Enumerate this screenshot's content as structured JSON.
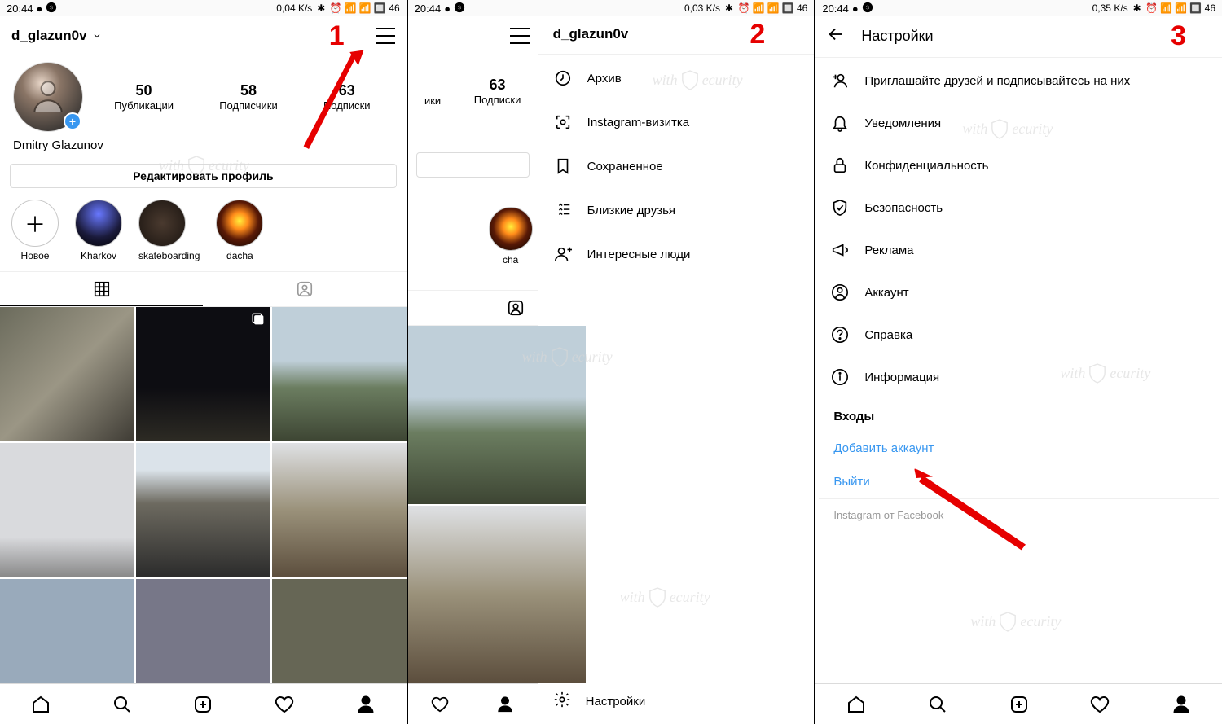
{
  "status": {
    "time": "20:44",
    "battery": "46",
    "rates": [
      "0,04 K/s",
      "0,03 K/s",
      "0,35 K/s"
    ]
  },
  "labels": {
    "1": "1",
    "2": "2",
    "3": "3"
  },
  "profile": {
    "username": "d_glazun0v",
    "display_name": "Dmitry Glazunov",
    "edit_button": "Редактировать профиль",
    "stats": {
      "posts": {
        "num": "50",
        "label": "Публикации"
      },
      "followers": {
        "num": "58",
        "label": "Подписчики"
      },
      "following": {
        "num": "63",
        "label": "Подписки"
      }
    },
    "highlights": {
      "new": "Новое",
      "kharkov": "Kharkov",
      "skate": "skateboarding",
      "dacha": "dacha"
    }
  },
  "panel2": {
    "following_num": "63",
    "following_label": "Подписки",
    "hl_label": "cha",
    "partial_followers_label": "ики"
  },
  "drawer": {
    "title": "d_glazun0v",
    "items": {
      "archive": "Архив",
      "nametag": "Instagram-визитка",
      "saved": "Сохраненное",
      "close_friends": "Близкие друзья",
      "discover": "Интересные люди"
    },
    "footer": "Настройки"
  },
  "settings": {
    "title": "Настройки",
    "items": {
      "invite": "Приглашайте друзей и подписывайтесь на них",
      "notifications": "Уведомления",
      "privacy": "Конфиденциальность",
      "security": "Безопасность",
      "ads": "Реклама",
      "account": "Аккаунт",
      "help": "Справка",
      "about": "Информация"
    },
    "logins_section": "Входы",
    "add_account": "Добавить аккаунт",
    "logout": "Выйти",
    "footer": "Instagram от Facebook"
  },
  "watermark": "withSecurity"
}
